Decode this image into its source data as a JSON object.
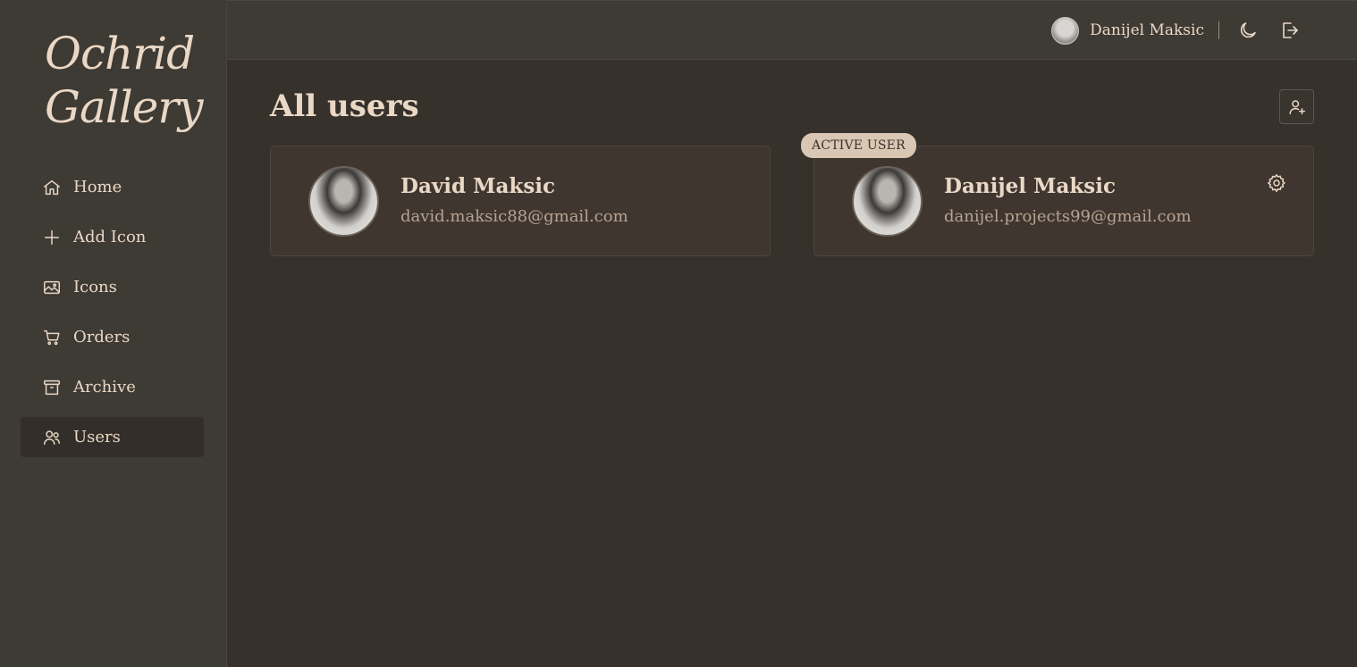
{
  "brand": {
    "logo": "Ochrid Gallery"
  },
  "sidebar": {
    "items": [
      {
        "label": "Home",
        "icon": "home-icon",
        "active": false
      },
      {
        "label": "Add Icon",
        "icon": "plus-icon",
        "active": false
      },
      {
        "label": "Icons",
        "icon": "image-icon",
        "active": false
      },
      {
        "label": "Orders",
        "icon": "cart-icon",
        "active": false
      },
      {
        "label": "Archive",
        "icon": "archive-icon",
        "active": false
      },
      {
        "label": "Users",
        "icon": "users-icon",
        "active": true
      }
    ]
  },
  "header": {
    "user_name": "Danijel Maksic",
    "icons": [
      "moon-icon",
      "logout-icon"
    ]
  },
  "main": {
    "title": "All users",
    "add_user_icon": "user-plus-icon",
    "users": [
      {
        "name": "David Maksic",
        "email": "david.maksic88@gmail.com",
        "active": false
      },
      {
        "name": "Danijel Maksic",
        "email": "danijel.projects99@gmail.com",
        "active": true,
        "badge": "ACTIVE USER"
      }
    ]
  },
  "colors": {
    "background": "#37312c",
    "sidebar": "#3e3a34",
    "card": "#3f3630",
    "text": "#ead8c6",
    "muted_text": "#b6a492",
    "badge_bg": "#d9c7b4"
  }
}
